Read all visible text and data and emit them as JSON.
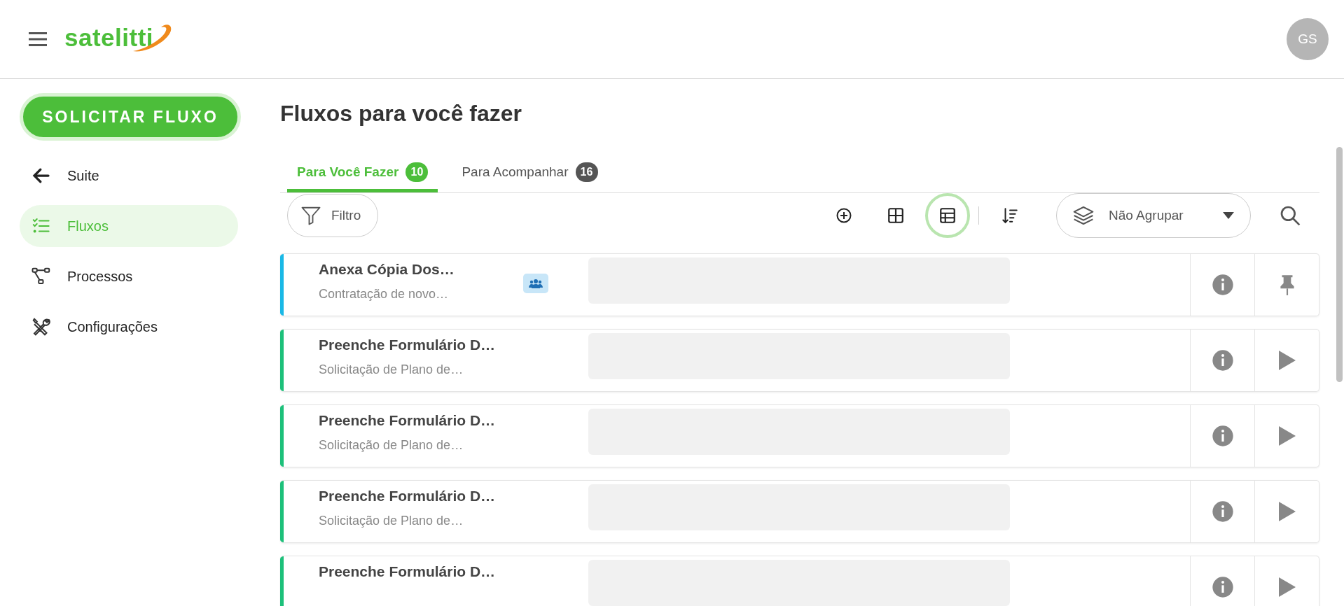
{
  "header": {
    "logo": "satelitti",
    "avatar": "GS"
  },
  "sidebar": {
    "action_button": "SOLICITAR FLUXO",
    "items": [
      {
        "kind": "back",
        "label": "Suite",
        "selected": false
      },
      {
        "kind": "flows",
        "label": "Fluxos",
        "selected": true
      },
      {
        "kind": "processes",
        "label": "Processos",
        "selected": false
      },
      {
        "kind": "settings",
        "label": "Configurações",
        "selected": false
      }
    ]
  },
  "page_title": "Fluxos para você fazer",
  "tabs": [
    {
      "label": "Para Você Fazer",
      "count": "10",
      "selected": true
    },
    {
      "label": "Para Acompanhar",
      "count": "16",
      "selected": false
    }
  ],
  "toolbar": {
    "filter": "Filtro",
    "views": [
      {
        "kind": "grid",
        "selected": false
      },
      {
        "kind": "table",
        "selected": true
      }
    ],
    "group_by": "Não Agrupar"
  },
  "rows": [
    {
      "title": "Anexa Cópia Dos…",
      "subtitle": "Contratação de novo…",
      "color": "#1ab8e6",
      "shared": true,
      "kind": "pinned"
    },
    {
      "title": "Preenche Formulário D…",
      "subtitle": "Solicitação de Plano de…",
      "color": "#1dc07a",
      "shared": false,
      "kind": "startable"
    },
    {
      "title": "Preenche Formulário D…",
      "subtitle": "Solicitação de Plano de…",
      "color": "#1dc07a",
      "shared": false,
      "kind": "startable"
    },
    {
      "title": "Preenche Formulário D…",
      "subtitle": "Solicitação de Plano de…",
      "color": "#1dc07a",
      "shared": false,
      "kind": "startable"
    },
    {
      "title": "Preenche Formulário D…",
      "color": "#1dc07a",
      "shared": false,
      "kind": "startable"
    }
  ]
}
